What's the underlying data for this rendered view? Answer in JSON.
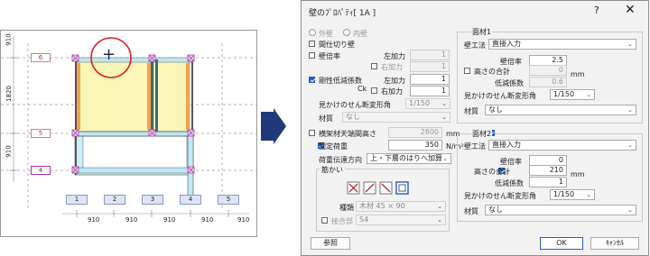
{
  "plan": {
    "top_dim": "910",
    "left_dims": [
      "1820",
      "910"
    ],
    "row_labels": [
      "6",
      "5",
      "4"
    ],
    "col_labels": [
      "1",
      "2",
      "3",
      "4",
      "5"
    ],
    "bottom_dims": [
      "910",
      "910",
      "910",
      "910",
      "910"
    ],
    "cursor": "+"
  },
  "dialog": {
    "title": "壁のﾌﾟﾛﾊﾟﾃｨ[ 1A ]",
    "help": "?",
    "close": "✕",
    "radio_outer": "外壁",
    "radio_inner": "内壁",
    "chk_partition": "間仕切り壁",
    "chk_wall_ratio": "壁倍率",
    "left_add": "左加力",
    "right_add": "右加力",
    "val_1a": "1",
    "val_1b": "1",
    "chk_rigid": "剛性低減係数",
    "ck": "Ck",
    "val_1c": "1",
    "val_1d": "1",
    "apparent_angle": "見かけのせん断変形角",
    "apparent_val": "1/150",
    "material": "材質",
    "material_val": "なし",
    "chk_ceiling": "横架材天端間高さ",
    "ceiling_val": "2800",
    "mm": "mm",
    "chk_fixed_load": "固定荷重",
    "fixed_load_val": "350",
    "load_unit": "N/m²",
    "load_dir": "荷重伝達方向",
    "load_dir_val": "上・下層のはりへ加算",
    "bracing": "筋かい",
    "kind": "種類",
    "kind_val": "木材 45 × 90",
    "chk_joint": "接合部",
    "joint_val": "S4",
    "ref_btn": "参照",
    "face1": {
      "title": "面材1",
      "wall_method": "壁工法",
      "method_val": "直接入力",
      "ratio": "壁倍率",
      "ratio_val": "2.5",
      "chk_height": "高さの合計",
      "height_val": "0",
      "mm": "mm",
      "reduce": "低減係数",
      "reduce_val": "0.6",
      "angle": "見かけのせん断変形角",
      "angle_val": "1/150",
      "material": "材質",
      "material_val": "なし"
    },
    "face2": {
      "title": "面材2",
      "wall_method": "壁工法",
      "method_val": "直接入力",
      "ratio": "壁倍率",
      "ratio_val": "0",
      "chk_height": "高さの合計",
      "height_val": "210",
      "mm": "mm",
      "reduce": "低減係数",
      "reduce_val": "1",
      "angle": "見かけのせん断変形角",
      "angle_val": "1/150",
      "material": "材質",
      "material_val": "なし"
    },
    "ok": "OK",
    "cancel": "ｷｬﾝｾﾙ"
  },
  "colors": {
    "accent": "#1f5fc8",
    "wall_fill": "#fbf5b8",
    "cyan": "#c8f0f8",
    "highlight": "#e02020"
  }
}
